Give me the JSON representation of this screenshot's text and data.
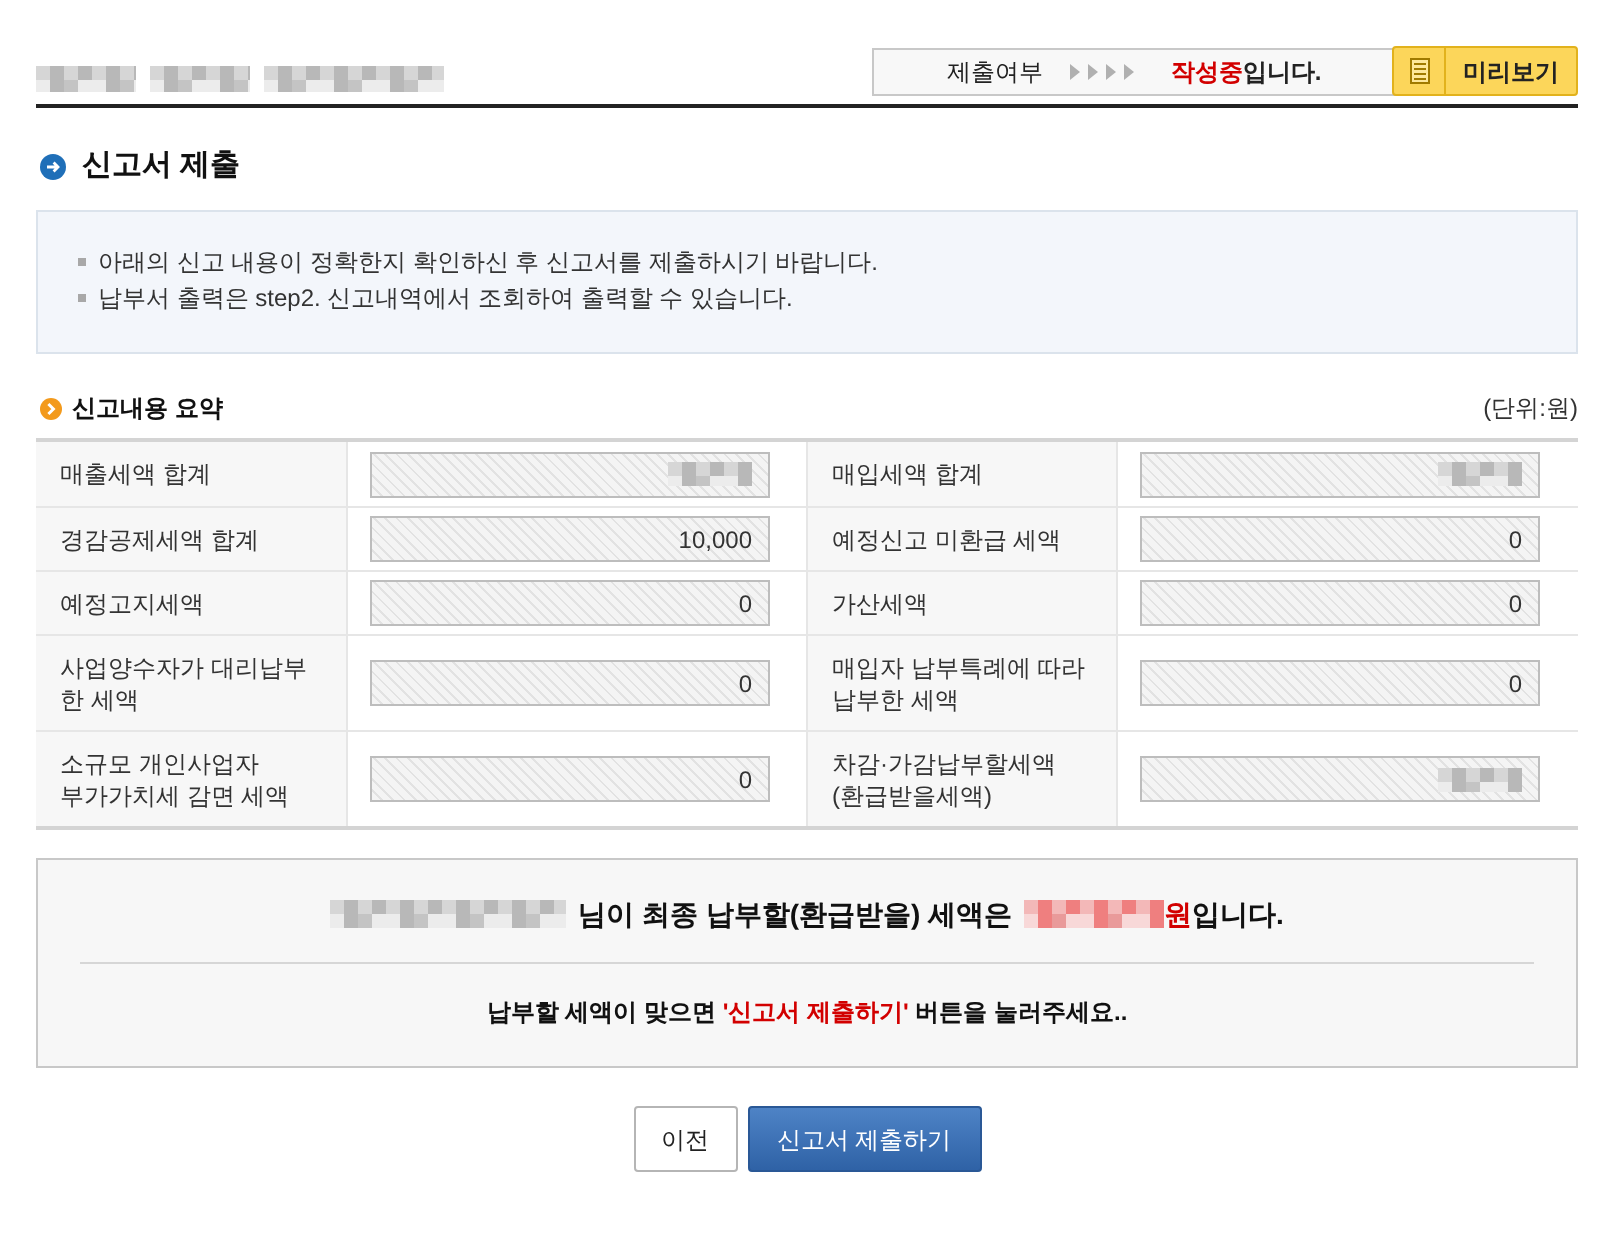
{
  "header": {
    "breadcrumb": [
      {
        "redacted": true
      },
      {
        "redacted": true
      },
      {
        "redacted": true
      }
    ],
    "status": {
      "label": "제출여부",
      "parts": [
        {
          "text": "작성중",
          "highlight": true
        },
        {
          "text": "입니다.",
          "highlight": false
        }
      ]
    },
    "preview_button": {
      "label": "미리보기"
    }
  },
  "page_title": "신고서 제출",
  "notice": [
    "아래의 신고 내용이 정확한지 확인하신 후 신고서를 제출하시기 바랍니다.",
    "납부서 출력은 step2. 신고내역에서 조회하여 출력할 수 있습니다."
  ],
  "summary": {
    "title": "신고내용 요약",
    "unit": "(단위:원)",
    "rows": [
      [
        {
          "label": "매출세액 합계",
          "redacted": true
        },
        {
          "label": "매입세액 합계",
          "redacted": true
        }
      ],
      [
        {
          "label": "경감공제세액 합계",
          "value": "10,000",
          "redacted": false
        },
        {
          "label": "예정신고 미환급 세액",
          "value": "0",
          "redacted": false
        }
      ],
      [
        {
          "label": "예정고지세액",
          "value": "0",
          "redacted": false
        },
        {
          "label": "가산세액",
          "value": "0",
          "redacted": false
        }
      ],
      [
        {
          "label": "사업양수자가 대리납부\n한 세액",
          "value": "0",
          "redacted": false
        },
        {
          "label": "매입자 납부특례에 따라\n납부한 세액",
          "value": "0",
          "redacted": false
        }
      ],
      [
        {
          "label": "소규모 개인사업자\n부가가치세 감면 세액",
          "value": "0",
          "redacted": false
        },
        {
          "label": "차감·가감납부할세액\n(환급받을세액)",
          "redacted": true
        }
      ]
    ]
  },
  "result": {
    "name": {
      "redacted": true
    },
    "text": "님이 최종 납부할(환급받을) 세액은",
    "amount": {
      "redacted": true
    },
    "amount_parts": [
      {
        "text": "원",
        "highlight": true
      },
      {
        "text": "입니다.",
        "highlight": false
      }
    ],
    "instruction_parts": [
      {
        "text": "납부할 세액이 맞으면 ",
        "highlight": false
      },
      {
        "text": "'신고서 제출하기'",
        "highlight": true
      },
      {
        "text": " 버튼을 눌러주세요..",
        "highlight": false
      }
    ]
  },
  "buttons": [
    {
      "label": "이전",
      "kind": "secondary"
    },
    {
      "label": "신고서 제출하기",
      "kind": "primary"
    }
  ]
}
